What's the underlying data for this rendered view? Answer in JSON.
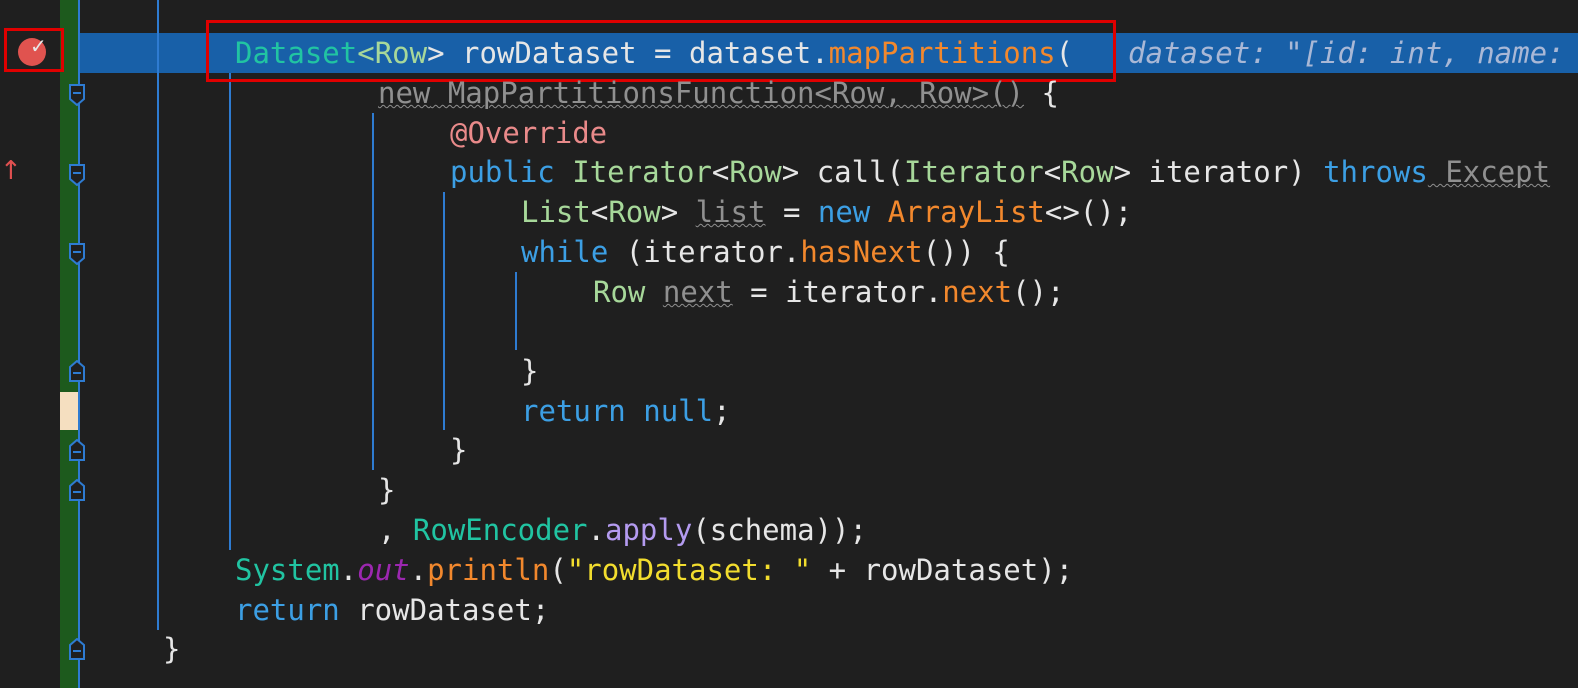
{
  "editor": {
    "line1": {
      "type_dataset": "Dataset",
      "lt": "<",
      "type_row": "Row",
      "gt": ">",
      "var_decl": " rowDataset = dataset.",
      "method": "mapPartitions",
      "paren": "(",
      "inline_hint": "dataset: \"[id: int, name:"
    },
    "line2": {
      "keyword_new": "new",
      "text": " MapPartitionsFunction<Row, Row>()",
      "brace": " {"
    },
    "line3": {
      "annotation": "@Override"
    },
    "line4": {
      "kw_public": "public",
      "iter1": "Iterator",
      "lt1": "<",
      "row1": "Row",
      "gt1": ">",
      "call": " call(",
      "iter2": "Iterator",
      "lt2": "<",
      "row2": "Row",
      "gt2": ">",
      "param": " iterator) ",
      "kw_throws": "throws",
      "exc": " Except"
    },
    "line5": {
      "list": "List",
      "lt": "<",
      "row": "Row",
      "gt": ">",
      "var": "list",
      "eq": " = ",
      "kw_new": "new",
      "arraylist": " ArrayList",
      "rest": "<>();"
    },
    "line6": {
      "kw_while": "while",
      "cond": " (iterator.",
      "method": "hasNext",
      "rest": "()) {"
    },
    "line7": {
      "row": "Row",
      "var": "next",
      "eq": " = iterator.",
      "method": "next",
      "rest": "();"
    },
    "line9": {
      "brace": "}"
    },
    "line10": {
      "kw_return": "return",
      "kw_null": "null",
      "semi": ";"
    },
    "line11": {
      "brace": "}"
    },
    "line12": {
      "brace": "}"
    },
    "line13": {
      "comma": ", ",
      "encoder": "RowEncoder",
      "dot": ".",
      "apply": "apply",
      "rest": "(schema));"
    },
    "line14": {
      "system": "System",
      "dot1": ".",
      "out": "out",
      "dot2": ".",
      "println": "println",
      "open": "(",
      "str": "\"rowDataset: \"",
      "rest": " + rowDataset);"
    },
    "line15": {
      "kw_return": "return",
      "rest": " rowDataset;"
    },
    "line16": {
      "brace": "}"
    }
  },
  "colors": {
    "background": "#1f1f1f",
    "execution_line": "#1860a8",
    "keyword": "#3c9fe4",
    "type": "#a7d89a",
    "class": "#21c4a2",
    "method": "#f2882d",
    "string": "#f2dd2e",
    "highlight_border": "#e00000"
  },
  "icons": {
    "breakpoint": "breakpoint-verified-icon",
    "fold": "fold-marker-icon",
    "override": "override-arrow-icon"
  }
}
